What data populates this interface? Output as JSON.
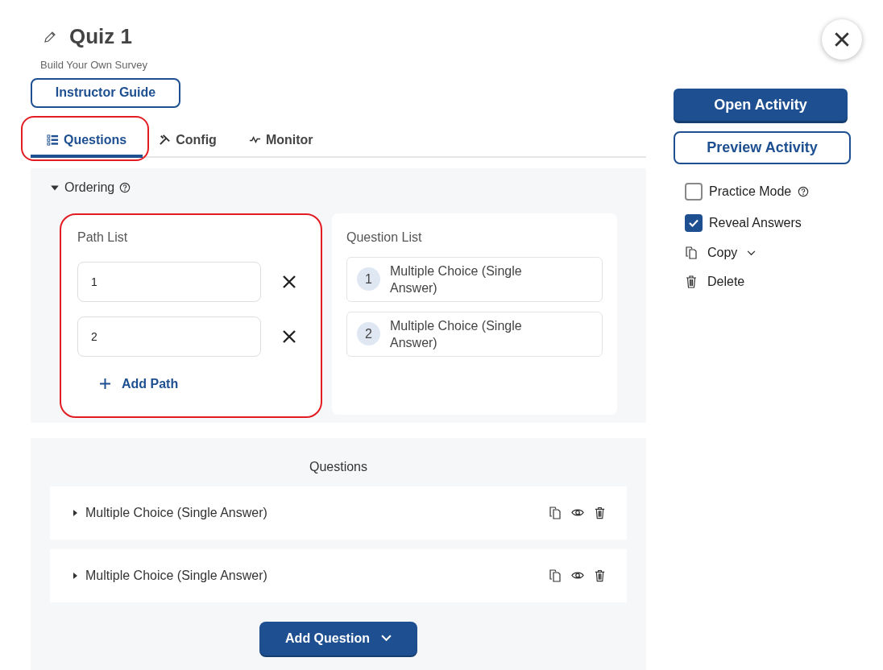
{
  "header": {
    "title": "Quiz 1",
    "subtitle": "Build Your Own Survey",
    "guide_button": "Instructor Guide"
  },
  "tabs": [
    {
      "label": "Questions",
      "selected": true,
      "highlighted": true
    },
    {
      "label": "Config",
      "selected": false,
      "highlighted": false
    },
    {
      "label": "Monitor",
      "selected": false,
      "highlighted": false
    }
  ],
  "ordering": {
    "label": "Ordering",
    "expanded": true,
    "path_list": {
      "title": "Path List",
      "highlighted": true,
      "paths": [
        "1",
        "2"
      ],
      "add_button": "Add Path"
    },
    "question_list": {
      "title": "Question List",
      "items": [
        {
          "number": "1",
          "label": "Multiple Choice (Single Answer)"
        },
        {
          "number": "2",
          "label": "Multiple Choice (Single Answer)"
        }
      ]
    }
  },
  "questions": {
    "title": "Questions",
    "items": [
      {
        "label": "Multiple Choice (Single Answer)",
        "expanded": false
      },
      {
        "label": "Multiple Choice (Single Answer)",
        "expanded": false
      }
    ],
    "add_button": "Add Question"
  },
  "sidebar": {
    "open_button": "Open Activity",
    "preview_button": "Preview Activity",
    "options": [
      {
        "kind": "checkbox",
        "label": "Practice Mode",
        "checked": false,
        "help": true
      },
      {
        "kind": "checkbox",
        "label": "Reveal Answers",
        "checked": true,
        "help": false
      },
      {
        "kind": "copy",
        "label": "Copy",
        "dropdown": true
      },
      {
        "kind": "delete",
        "label": "Delete",
        "dropdown": false
      }
    ]
  }
}
